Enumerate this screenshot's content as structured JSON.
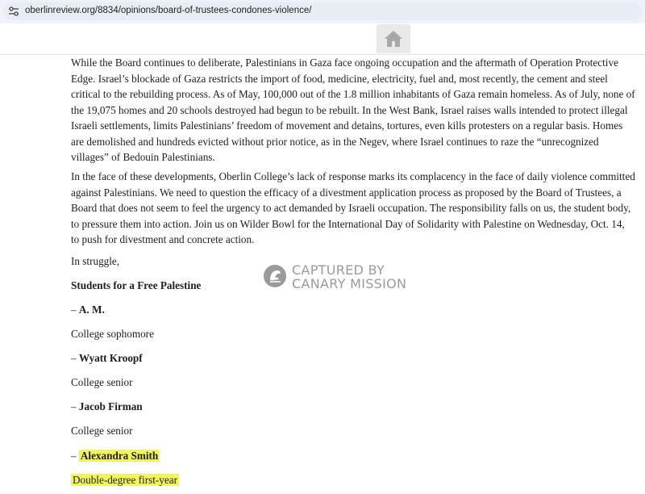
{
  "browser": {
    "url": "oberlinreview.org/8834/opinions/board-of-trustees-condones-violence/"
  },
  "header": {
    "home_icon": "home-icon"
  },
  "article": {
    "paragraph_1": "While the Board continues to deliberate, Palestinians in Gaza face ongoing occupation and the aftermath of Operation Protective Edge. Israel’s blockade of Gaza restricts the import of food, medicine, electricity, fuel and, most recently, the cement and steel critical to the rebuilding process. As of May, 100,000 out of the 1.8 million inhabitants of Gaza remain homeless. As of July, none of the 19,075 homes and 20 schools destroyed had begun to be rebuilt. In the West Bank, Israel raises walls intended to protect illegal Israeli settlements, limits Palestinians’ freedom of movement and detains, tortures, even kills protesters on a regular basis. Homes are demolished and hundreds evicted without prior notice, as in the Negev, where Israel continues to raze the “unrecognized villages” of Bedouin Palestinians.",
    "paragraph_2": "In the face of these developments, Oberlin College’s lack of response marks its complacency in the face of daily violence committed against Palestinians. We need to question the efficacy of a divestment application process as proposed by the Board of Trustees, a Board that does not seem to feel the urgency to act demanded by Israeli occupation. The responsibility falls on us, the student body, to pressure them into action. Join us on Wilder Bowl for the International Day of Solidarity with Palestine on Wednesday, Oct. 14, to push for divestment and concrete action.",
    "closing": "In struggle,",
    "group": "Students for a Free Palestine",
    "dash": "–",
    "signatories": [
      {
        "name": "A. M.",
        "role": "College sophomore"
      },
      {
        "name": "Wyatt Kroopf",
        "role": "College senior"
      },
      {
        "name": "Jacob Firman",
        "role": "College senior"
      },
      {
        "name": "Alexandra Smith",
        "role": "Double-degree first-year"
      }
    ]
  },
  "watermark": {
    "line1": "CAPTURED BY",
    "line2": "CANARY MISSION",
    "icon": "canary-logo-icon"
  },
  "colors": {
    "highlight": "#f2f55a",
    "watermark": "#9a9a9a"
  }
}
